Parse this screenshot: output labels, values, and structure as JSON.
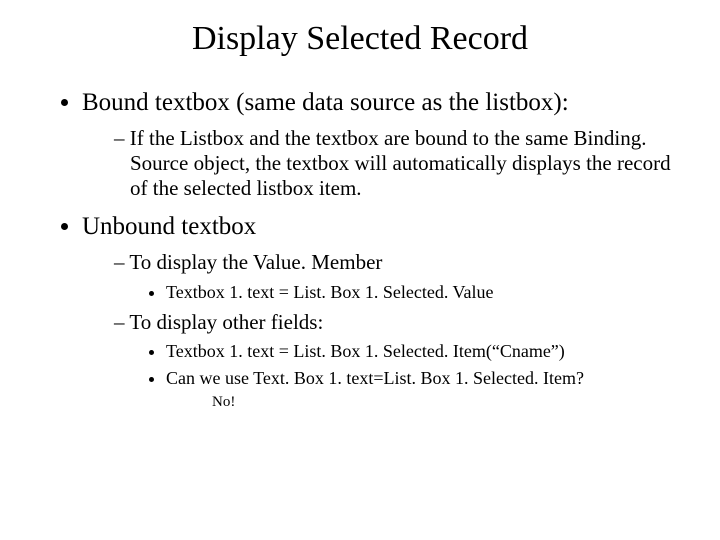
{
  "title": "Display Selected Record",
  "bullets": {
    "item1": {
      "text": "Bound textbox (same data source as the listbox):",
      "sub1": {
        "text": "If the Listbox and the textbox are bound to the same Binding. Source object, the textbox will automatically displays the record of the selected listbox item."
      }
    },
    "item2": {
      "text": "Unbound textbox",
      "sub1": {
        "text": "To display the Value. Member",
        "d1": "Textbox 1. text = List. Box 1. Selected. Value"
      },
      "sub2": {
        "text": "To display other fields:",
        "d1": "Textbox 1. text = List. Box 1. Selected. Item(“Cname”)",
        "d2": "Can we use Text. Box 1. text=List. Box 1. Selected. Item?",
        "d2a": "No!"
      }
    }
  }
}
